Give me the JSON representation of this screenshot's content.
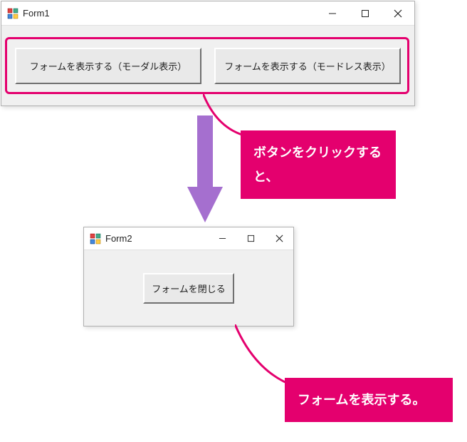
{
  "form1": {
    "title": "Form1",
    "button_modal": "フォームを表示する（モーダル表示）",
    "button_modeless": "フォームを表示する（モードレス表示）"
  },
  "form2": {
    "title": "Form2",
    "button_close": "フォームを閉じる"
  },
  "callout1_text": "ボタンをクリックすると、",
  "callout2_text": "フォームを表示する。",
  "icons": {
    "minimize": "minimize-icon",
    "maximize": "maximize-icon",
    "close": "close-icon",
    "app": "form-app-icon"
  },
  "colors": {
    "accent": "#e4006e",
    "arrow": "#a56fcf",
    "window_bg": "#f0f0f0"
  }
}
